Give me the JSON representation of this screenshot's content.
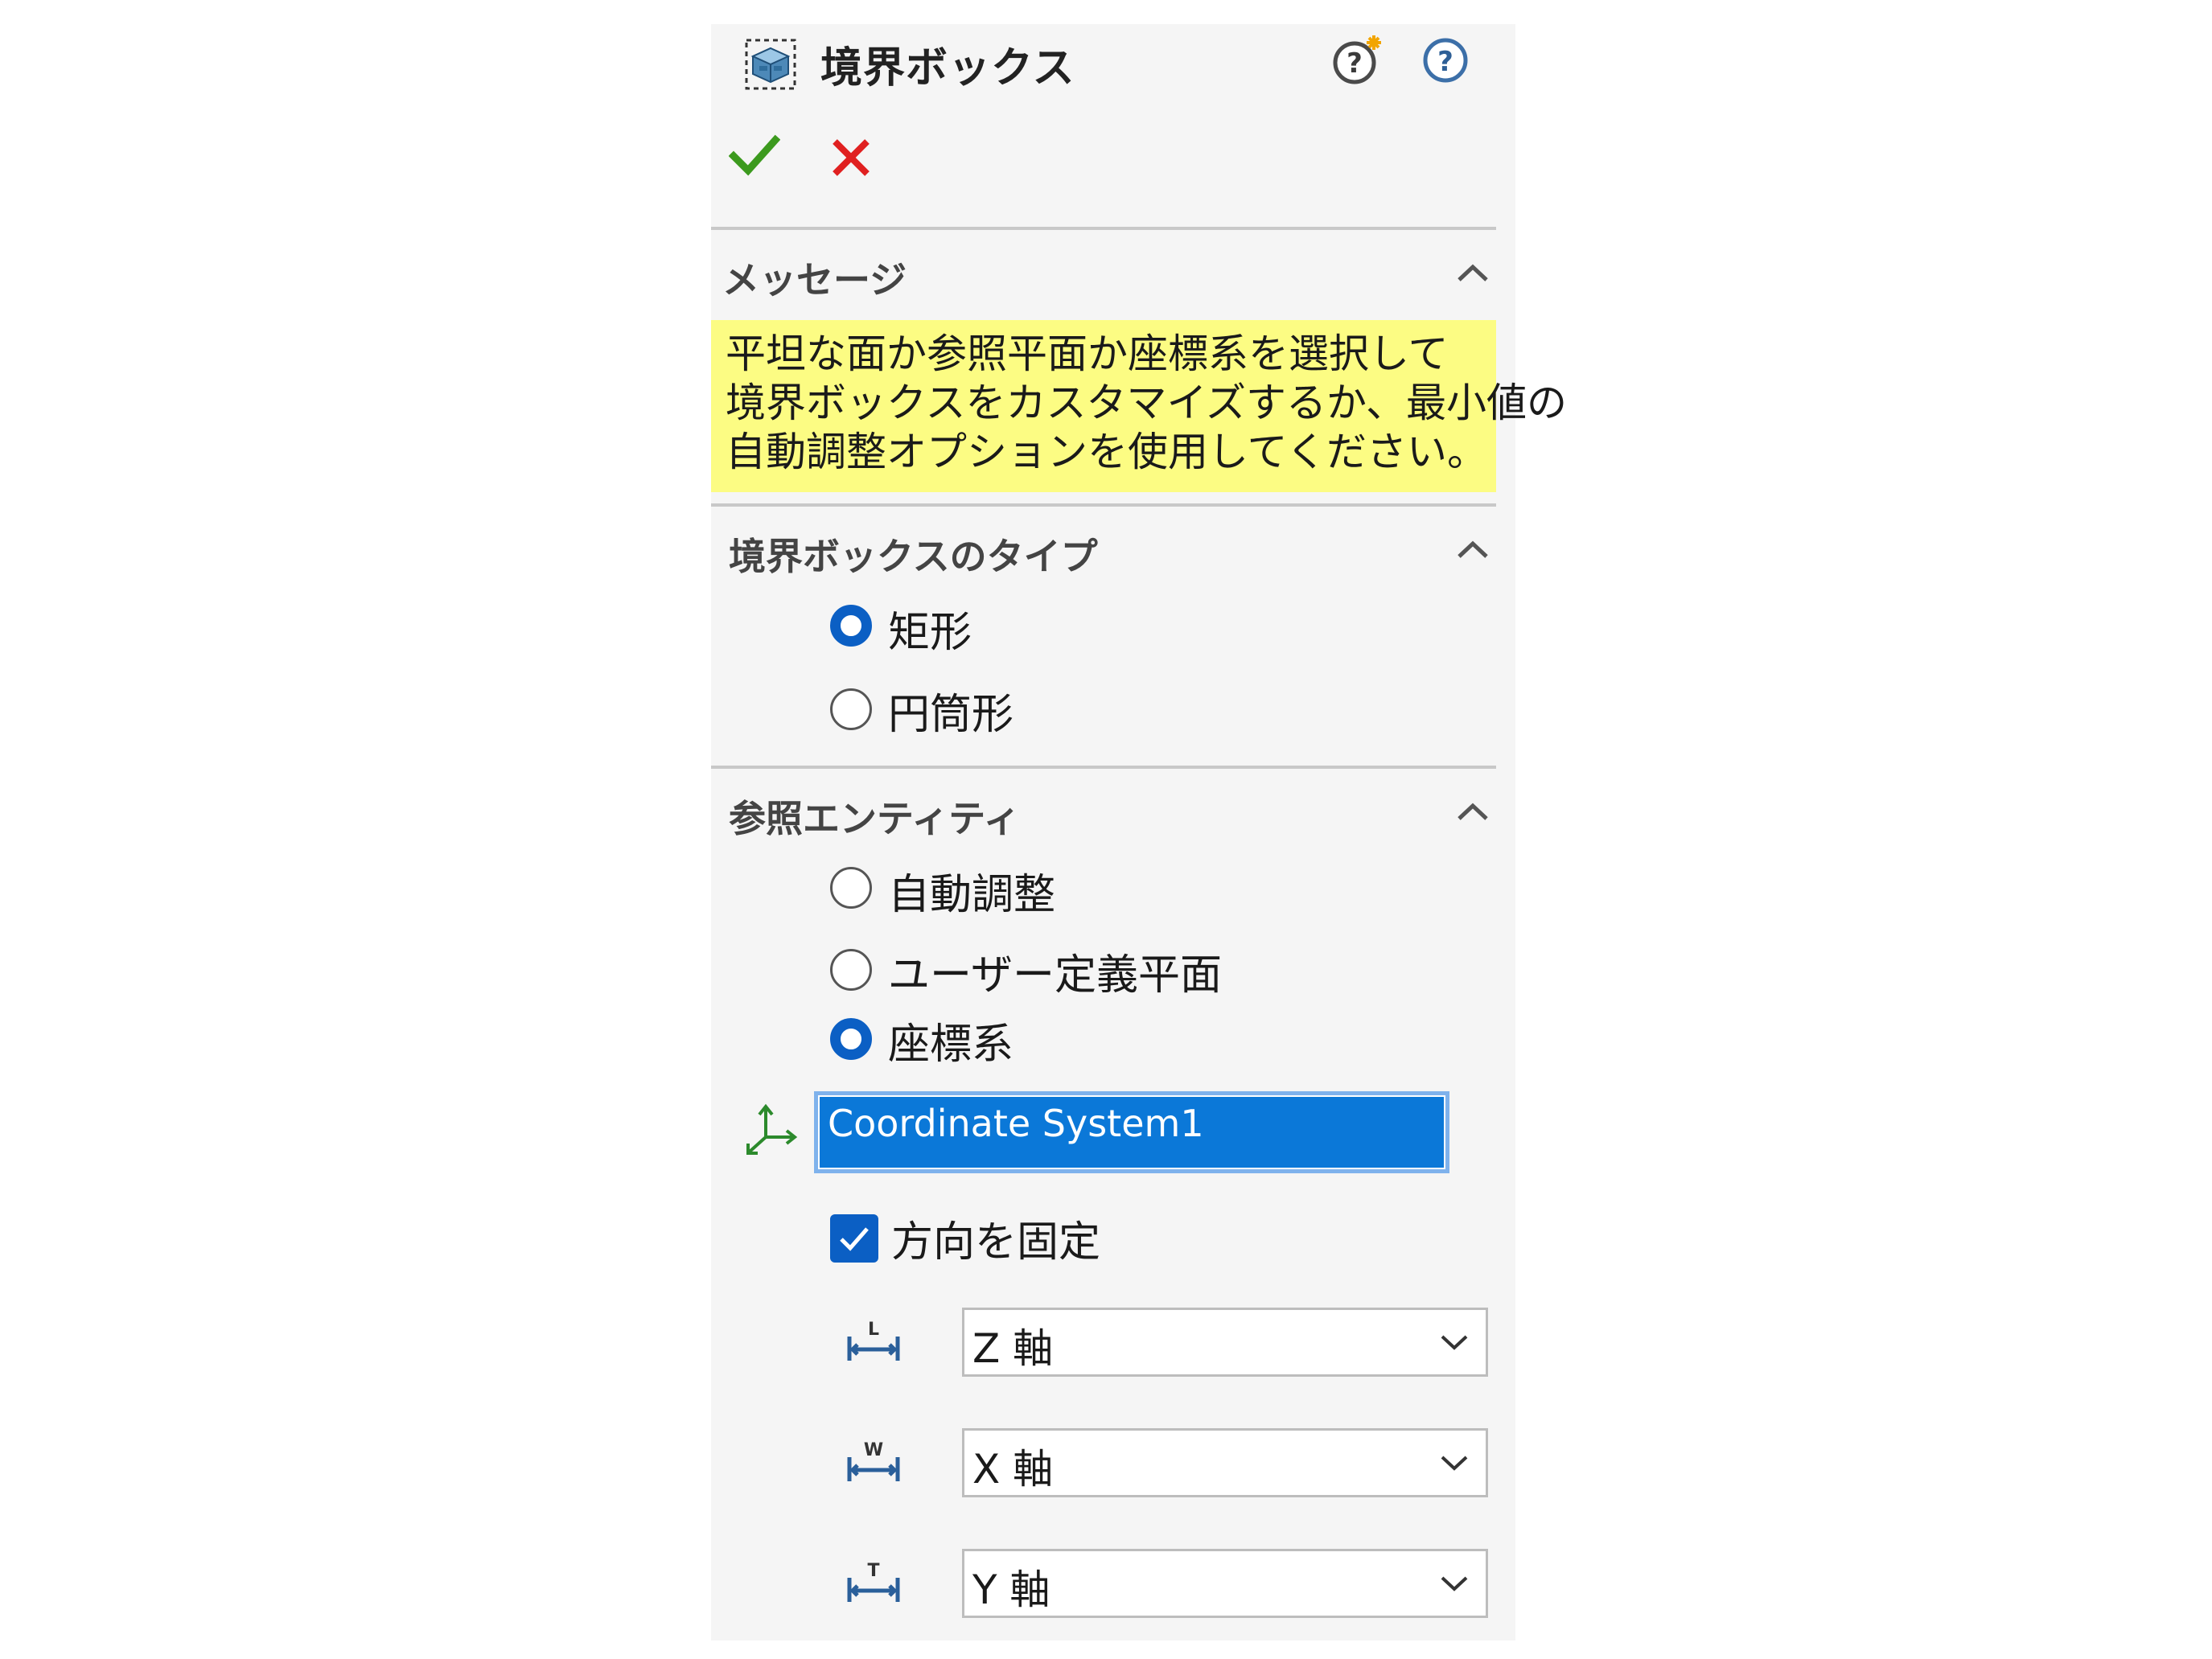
{
  "header": {
    "title": "境界ボックス",
    "icons": [
      "bounding-box-icon",
      "whats-wrong-help-icon",
      "help-icon"
    ]
  },
  "actions": {
    "ok": "check-icon",
    "cancel": "close-icon"
  },
  "message_section": {
    "header": "メッセージ",
    "lines": [
      "平坦な面か参照平面か座標系を選択して",
      "境界ボックスをカスタマイズするか、最小値の",
      "自動調整オプションを使用してください。"
    ],
    "bg_color": "#fcfc83"
  },
  "type_section": {
    "header": "境界ボックスのタイプ",
    "options": [
      {
        "label": "矩形",
        "selected": true
      },
      {
        "label": "円筒形",
        "selected": false
      }
    ]
  },
  "reference_section": {
    "header": "参照エンティティ",
    "options": [
      {
        "label": "自動調整",
        "selected": false
      },
      {
        "label": "ユーザー定義平面",
        "selected": false
      },
      {
        "label": "座標系",
        "selected": true
      }
    ],
    "selection_value": "Coordinate System1",
    "fix_direction": {
      "label": "方向を固定",
      "checked": true
    },
    "axes": [
      {
        "icon": "length-dimension-icon",
        "value": "Z 軸"
      },
      {
        "icon": "width-dimension-icon",
        "value": "X 軸"
      },
      {
        "icon": "thickness-dimension-icon",
        "value": "Y 軸"
      }
    ]
  },
  "colors": {
    "accent": "#0b5fc4",
    "selection": "#0b78d8",
    "ok_green": "#3c9a1e",
    "cancel_red": "#e02020"
  }
}
